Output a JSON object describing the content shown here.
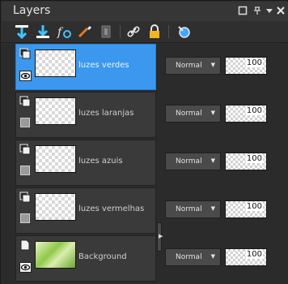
{
  "panel": {
    "title": "Layers"
  },
  "window_buttons": [
    "maximize-icon",
    "pin-icon",
    "menu-down-icon",
    "close-icon"
  ],
  "toolbar": {
    "buttons": [
      "new-raster-layer-icon",
      "new-vector-layer-icon",
      "fx-effects-icon",
      "brush-edit-icon",
      "duplicate-layer-icon",
      "link-icon",
      "lock-icon",
      "pin-highlight-icon"
    ]
  },
  "colors": {
    "selection": "#3b98ee",
    "row": "#3a3a3a",
    "panel": "#2f2f2f"
  },
  "layers": [
    {
      "name": "luzes verdes",
      "blend_mode": "Normal",
      "opacity": "100",
      "visible": true,
      "selected": true
    },
    {
      "name": "luzes laranjas",
      "blend_mode": "Normal",
      "opacity": "100",
      "visible": false,
      "selected": false
    },
    {
      "name": "luzes azuis",
      "blend_mode": "Normal",
      "opacity": "100",
      "visible": false,
      "selected": false
    },
    {
      "name": "luzes vermelhas",
      "blend_mode": "Normal",
      "opacity": "100",
      "visible": false,
      "selected": false
    },
    {
      "name": "Background",
      "blend_mode": "Normal",
      "opacity": "100",
      "visible": true,
      "selected": false
    }
  ]
}
